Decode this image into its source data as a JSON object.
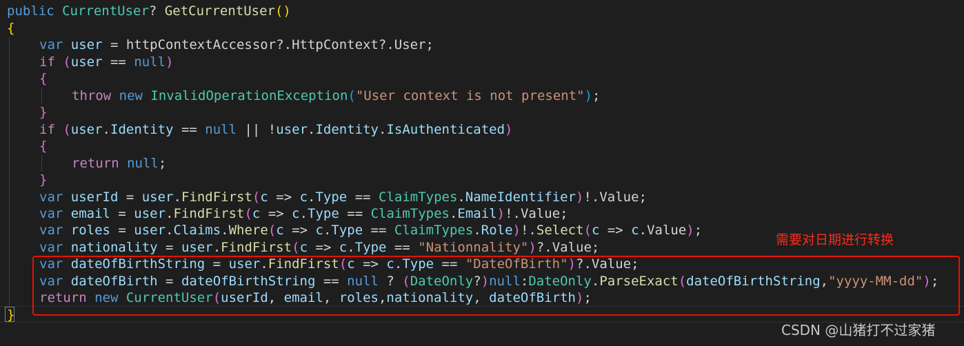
{
  "editor": {
    "lines": [
      [
        [
          "kw",
          "public "
        ],
        [
          "type",
          "CurrentUser"
        ],
        [
          "plain",
          "? "
        ],
        [
          "fn",
          "GetCurrentUser"
        ],
        [
          "br1",
          "()"
        ]
      ],
      [
        [
          "br1",
          "{"
        ]
      ],
      [
        [
          "kw",
          "var "
        ],
        [
          "var",
          "user"
        ],
        [
          "plain",
          " = httpContextAccessor?.HttpContext?.User;"
        ]
      ],
      [
        [
          "ctl",
          "if "
        ],
        [
          "br2",
          "("
        ],
        [
          "var",
          "user"
        ],
        [
          "plain",
          " == "
        ],
        [
          "kw",
          "null"
        ],
        [
          "br2",
          ")"
        ]
      ],
      [
        [
          "br2",
          "{"
        ]
      ],
      [
        [
          "ctl",
          "throw "
        ],
        [
          "kw",
          "new "
        ],
        [
          "type",
          "InvalidOperationException"
        ],
        [
          "br3",
          "("
        ],
        [
          "str",
          "\"User context is not present\""
        ],
        [
          "br3",
          ")"
        ],
        [
          "plain",
          ";"
        ]
      ],
      [
        [
          "br2",
          "}"
        ]
      ],
      [
        [
          "ctl",
          "if "
        ],
        [
          "br2",
          "("
        ],
        [
          "var",
          "user"
        ],
        [
          "plain",
          "."
        ],
        [
          "var",
          "Identity"
        ],
        [
          "plain",
          " == "
        ],
        [
          "kw",
          "null"
        ],
        [
          "plain",
          " || !"
        ],
        [
          "var",
          "user"
        ],
        [
          "plain",
          "."
        ],
        [
          "var",
          "Identity"
        ],
        [
          "plain",
          "."
        ],
        [
          "var",
          "IsAuthenticated"
        ],
        [
          "br2",
          ")"
        ]
      ],
      [
        [
          "br2",
          "{"
        ]
      ],
      [
        [
          "ctl",
          "return "
        ],
        [
          "kw",
          "null"
        ],
        [
          "plain",
          ";"
        ]
      ],
      [
        [
          "br2",
          "}"
        ]
      ],
      [
        [
          "kw",
          "var "
        ],
        [
          "var",
          "userId"
        ],
        [
          "plain",
          " = "
        ],
        [
          "var",
          "user"
        ],
        [
          "plain",
          "."
        ],
        [
          "fn",
          "FindFirst"
        ],
        [
          "br2",
          "("
        ],
        [
          "var",
          "c"
        ],
        [
          "plain",
          " => "
        ],
        [
          "var",
          "c"
        ],
        [
          "plain",
          "."
        ],
        [
          "var",
          "Type"
        ],
        [
          "plain",
          " == "
        ],
        [
          "type",
          "ClaimTypes"
        ],
        [
          "plain",
          "."
        ],
        [
          "var",
          "NameIdentifier"
        ],
        [
          "br2",
          ")"
        ],
        [
          "plain",
          "!.Value;"
        ]
      ],
      [
        [
          "kw",
          "var "
        ],
        [
          "var",
          "email"
        ],
        [
          "plain",
          " = "
        ],
        [
          "var",
          "user"
        ],
        [
          "plain",
          "."
        ],
        [
          "fn",
          "FindFirst"
        ],
        [
          "br2",
          "("
        ],
        [
          "var",
          "c"
        ],
        [
          "plain",
          " => "
        ],
        [
          "var",
          "c"
        ],
        [
          "plain",
          "."
        ],
        [
          "var",
          "Type"
        ],
        [
          "plain",
          " == "
        ],
        [
          "type",
          "ClaimTypes"
        ],
        [
          "plain",
          "."
        ],
        [
          "var",
          "Email"
        ],
        [
          "br2",
          ")"
        ],
        [
          "plain",
          "!.Value;"
        ]
      ],
      [
        [
          "kw",
          "var "
        ],
        [
          "var",
          "roles"
        ],
        [
          "plain",
          " = "
        ],
        [
          "var",
          "user"
        ],
        [
          "plain",
          "."
        ],
        [
          "var",
          "Claims"
        ],
        [
          "plain",
          "."
        ],
        [
          "fn",
          "Where"
        ],
        [
          "br2",
          "("
        ],
        [
          "var",
          "c"
        ],
        [
          "plain",
          " => "
        ],
        [
          "var",
          "c"
        ],
        [
          "plain",
          "."
        ],
        [
          "var",
          "Type"
        ],
        [
          "plain",
          " == "
        ],
        [
          "type",
          "ClaimTypes"
        ],
        [
          "plain",
          "."
        ],
        [
          "var",
          "Role"
        ],
        [
          "br2",
          ")"
        ],
        [
          "plain",
          "!."
        ],
        [
          "fn",
          "Select"
        ],
        [
          "br2",
          "("
        ],
        [
          "var",
          "c"
        ],
        [
          "plain",
          " => "
        ],
        [
          "var",
          "c"
        ],
        [
          "plain",
          ".Value"
        ],
        [
          "br2",
          ")"
        ],
        [
          "plain",
          ";"
        ]
      ],
      [
        [
          "kw",
          "var "
        ],
        [
          "var",
          "nationality"
        ],
        [
          "plain",
          " = "
        ],
        [
          "var",
          "user"
        ],
        [
          "plain",
          "."
        ],
        [
          "fn",
          "FindFirst"
        ],
        [
          "br2",
          "("
        ],
        [
          "var",
          "c"
        ],
        [
          "plain",
          " => "
        ],
        [
          "var",
          "c"
        ],
        [
          "plain",
          "."
        ],
        [
          "var",
          "Type"
        ],
        [
          "plain",
          " == "
        ],
        [
          "str",
          "\"Nationnality\""
        ],
        [
          "br2",
          ")"
        ],
        [
          "plain",
          "?.Value;"
        ]
      ],
      [
        [
          "kw",
          "var "
        ],
        [
          "var",
          "dateOfBirthString"
        ],
        [
          "plain",
          " = "
        ],
        [
          "var",
          "user"
        ],
        [
          "plain",
          "."
        ],
        [
          "fn",
          "FindFirst"
        ],
        [
          "br2",
          "("
        ],
        [
          "var",
          "c"
        ],
        [
          "plain",
          " => "
        ],
        [
          "var",
          "c"
        ],
        [
          "plain",
          "."
        ],
        [
          "var",
          "Type"
        ],
        [
          "plain",
          " == "
        ],
        [
          "str",
          "\"DateOfBirth\""
        ],
        [
          "br2",
          ")"
        ],
        [
          "plain",
          "?.Value;"
        ]
      ],
      [
        [
          "kw",
          "var "
        ],
        [
          "var",
          "dateOfBirth"
        ],
        [
          "plain",
          " = "
        ],
        [
          "var",
          "dateOfBirthString"
        ],
        [
          "plain",
          " == "
        ],
        [
          "kw",
          "null"
        ],
        [
          "plain",
          " ? "
        ],
        [
          "br2",
          "("
        ],
        [
          "type",
          "DateOnly"
        ],
        [
          "plain",
          "?"
        ],
        [
          "br2",
          ")"
        ],
        [
          "kw",
          "null"
        ],
        [
          "plain",
          ":"
        ],
        [
          "type",
          "DateOnly"
        ],
        [
          "plain",
          "."
        ],
        [
          "fn",
          "ParseExact"
        ],
        [
          "br2",
          "("
        ],
        [
          "var",
          "dateOfBirthString"
        ],
        [
          "plain",
          ","
        ],
        [
          "str",
          "\"yyyy-MM-dd\""
        ],
        [
          "br2",
          ")"
        ],
        [
          "plain",
          ";"
        ]
      ],
      [
        [
          "ctl",
          "return "
        ],
        [
          "kw",
          "new "
        ],
        [
          "type",
          "CurrentUser"
        ],
        [
          "br2",
          "("
        ],
        [
          "var",
          "userId"
        ],
        [
          "plain",
          ", "
        ],
        [
          "var",
          "email"
        ],
        [
          "plain",
          ", "
        ],
        [
          "var",
          "roles"
        ],
        [
          "plain",
          ","
        ],
        [
          "var",
          "nationality"
        ],
        [
          "plain",
          ", "
        ],
        [
          "var",
          "dateOfBirth"
        ],
        [
          "br2",
          ")"
        ],
        [
          "plain",
          ";"
        ]
      ],
      [
        [
          "br1",
          "}"
        ]
      ]
    ]
  },
  "annotation": {
    "text": "需要对日期进行转换",
    "color": "#ff2a1a"
  },
  "watermark": {
    "text": "CSDN @山猪打不过家猪"
  }
}
